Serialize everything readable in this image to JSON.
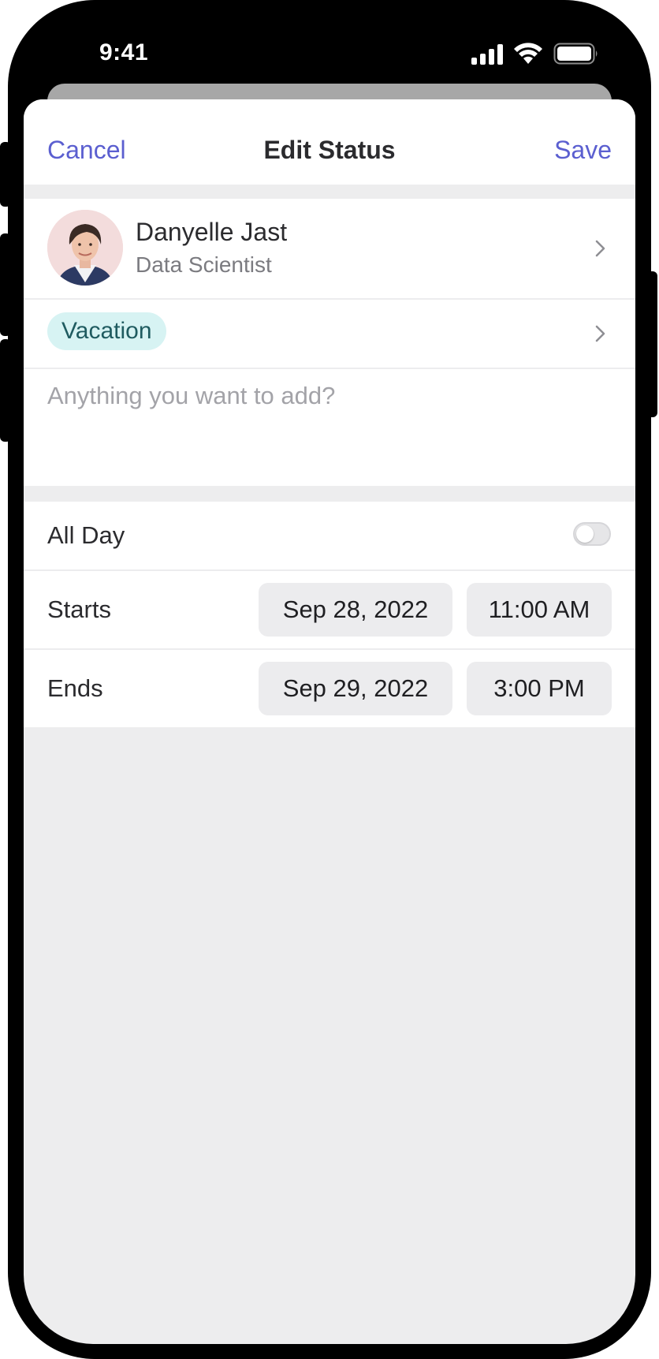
{
  "status_bar": {
    "time": "9:41",
    "icons": [
      "cellular-icon",
      "wifi-icon",
      "battery-icon"
    ]
  },
  "nav": {
    "cancel_label": "Cancel",
    "title": "Edit Status",
    "save_label": "Save"
  },
  "person": {
    "name": "Danyelle Jast",
    "role": "Data Scientist"
  },
  "status": {
    "label": "Vacation",
    "pill_color": "#d7f3f3",
    "text_color": "#1f5b60"
  },
  "note": {
    "value": "",
    "placeholder": "Anything you want to add?"
  },
  "schedule": {
    "all_day_label": "All Day",
    "all_day_on": false,
    "starts_label": "Starts",
    "start_date": "Sep 28, 2022",
    "start_time": "11:00 AM",
    "ends_label": "Ends",
    "end_date": "Sep 29, 2022",
    "end_time": "3:00 PM"
  },
  "colors": {
    "accent": "#5b5fd0",
    "background": "#ededee"
  }
}
